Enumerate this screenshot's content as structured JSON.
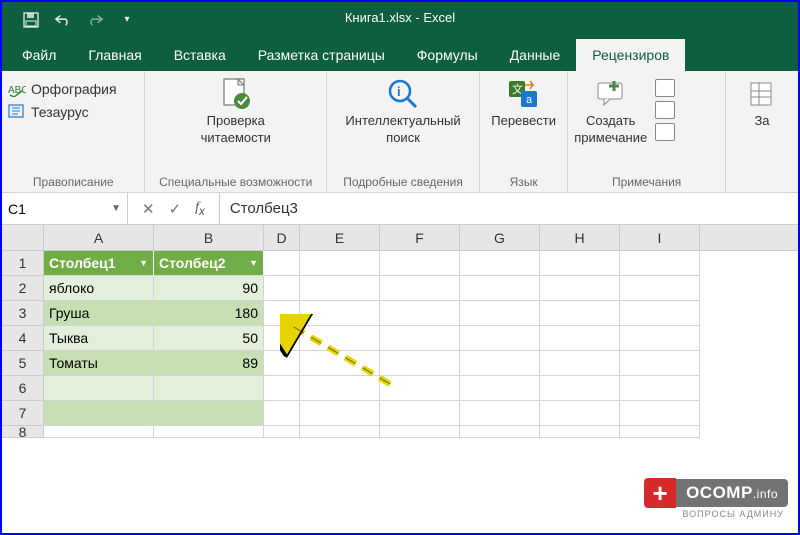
{
  "app": {
    "title": "Книга1.xlsx  -  Excel"
  },
  "tabs": {
    "file": "Файл",
    "home": "Главная",
    "insert": "Вставка",
    "page_layout": "Разметка страницы",
    "formulas": "Формулы",
    "data": "Данные",
    "review": "Рецензиров"
  },
  "ribbon": {
    "proofing": {
      "spelling": "Орфография",
      "thesaurus": "Тезаурус",
      "group_label": "Правописание"
    },
    "accessibility": {
      "check_line1": "Проверка",
      "check_line2": "читаемости",
      "group_label": "Специальные возможности"
    },
    "insights": {
      "smart_line1": "Интеллектуальный",
      "smart_line2": "поиск",
      "group_label": "Подробные сведения"
    },
    "language": {
      "translate": "Перевести",
      "group_label": "Язык"
    },
    "comments": {
      "new_line1": "Создать",
      "new_line2": "примечание",
      "group_label": "Примечания"
    },
    "changes": {
      "btn": "За"
    }
  },
  "namebox": "C1",
  "formula_bar": "Столбец3",
  "columns": [
    "A",
    "B",
    "D",
    "E",
    "F",
    "G",
    "H",
    "I"
  ],
  "table": {
    "headers": {
      "col1": "Столбец1",
      "col2": "Столбец2"
    },
    "rows": [
      {
        "a": "яблоко",
        "b": "90"
      },
      {
        "a": "Груша",
        "b": "180"
      },
      {
        "a": "Тыква",
        "b": "50"
      },
      {
        "a": "Томаты",
        "b": "89"
      }
    ]
  },
  "row_numbers": [
    "1",
    "2",
    "3",
    "4",
    "5",
    "6",
    "7",
    "8"
  ],
  "watermark": {
    "brand": "OCOMP",
    "tld": ".info",
    "sub": "ВОПРОСЫ АДМИНУ"
  }
}
